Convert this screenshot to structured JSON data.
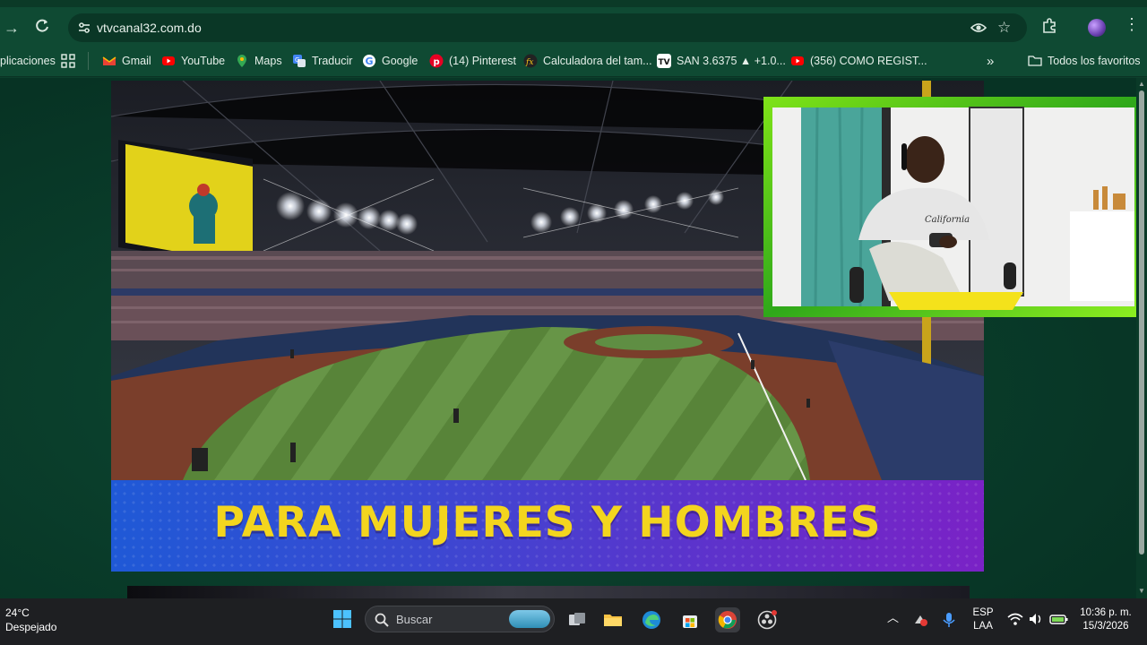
{
  "browser": {
    "url": "vtvcanal32.com.do",
    "bookmarks": [
      {
        "label": "plicaciones",
        "icon": "apps-icon"
      },
      {
        "label": "Gmail",
        "icon": "gmail-icon"
      },
      {
        "label": "YouTube",
        "icon": "youtube-icon"
      },
      {
        "label": "Maps",
        "icon": "maps-icon"
      },
      {
        "label": "Traducir",
        "icon": "translate-icon"
      },
      {
        "label": "Google",
        "icon": "google-icon"
      },
      {
        "label": "(14) Pinterest",
        "icon": "pinterest-icon"
      },
      {
        "label": "Calculadora del tam...",
        "icon": "calculator-icon"
      },
      {
        "label": "SAN 3.6375 ▲ +1.0...",
        "icon": "tradingview-icon"
      },
      {
        "label": "(356) COMO REGIST...",
        "icon": "youtube-icon"
      }
    ],
    "all_bookmarks_label": "Todos los favoritos"
  },
  "page": {
    "banner_text": "PARA MUJERES Y HOMBRES",
    "webcam_shirt_text": "California"
  },
  "taskbar": {
    "weather_temp": "24°C",
    "weather_desc": "Despejado",
    "search_placeholder": "Buscar",
    "language_line1": "ESP",
    "language_line2": "LAA",
    "time": "10:36 p. m.",
    "date": "15/3/2026"
  }
}
